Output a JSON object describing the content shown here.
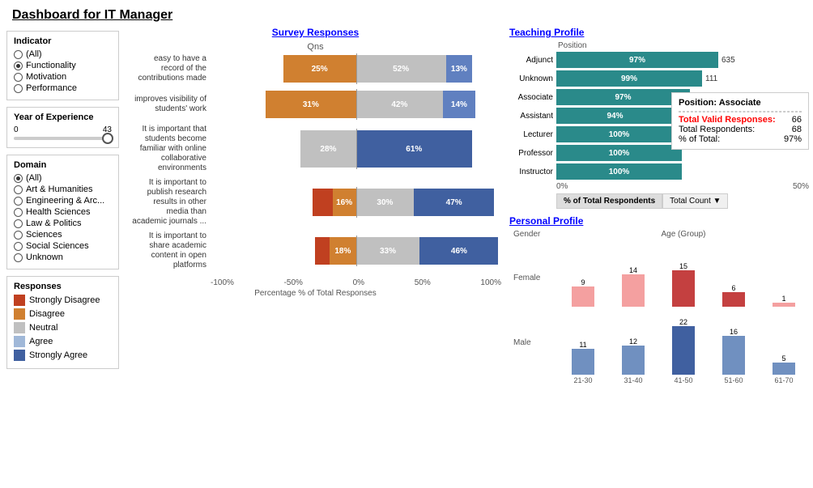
{
  "title": "Dashboard for IT Manager",
  "survey": {
    "section_title": "Survey Responses",
    "qns_label": "Qns",
    "x_axis_title": "Percentage % of Total Responses",
    "x_labels": [
      "-100%",
      "-50%",
      "0%",
      "50%",
      "100%"
    ],
    "questions": [
      {
        "label": "easy to have a record of the contributions made",
        "segments": [
          {
            "color": "#d08030",
            "width_pct": 25,
            "label": "25%",
            "side": "neg"
          },
          {
            "color": "#c0c0c0",
            "width_pct": 52,
            "label": "52%",
            "side": "pos"
          },
          {
            "color": "#6080c0",
            "width_pct": 13,
            "label": "13%",
            "side": "pos"
          }
        ]
      },
      {
        "label": "improves visibility of students' work",
        "segments": [
          {
            "color": "#d08030",
            "width_pct": 31,
            "label": "31%",
            "side": "neg"
          },
          {
            "color": "#c0c0c0",
            "width_pct": 42,
            "label": "42%",
            "side": "pos"
          },
          {
            "color": "#6080c0",
            "width_pct": 14,
            "label": "14%",
            "side": "pos"
          }
        ]
      },
      {
        "label": "It is important that students become familiar with online collaborative environments",
        "segments": [
          {
            "color": "#c0c0c0",
            "width_pct": 28,
            "label": "28%",
            "side": "neg"
          },
          {
            "color": "#6080c0",
            "width_pct": 61,
            "label": "61%",
            "side": "pos"
          }
        ]
      },
      {
        "label": "It is important to publish research results in other media than academic journals ...",
        "segments": [
          {
            "color": "#d08030",
            "width_pct": 16,
            "label": "16%",
            "side": "neg"
          },
          {
            "color": "#c0c0c0",
            "width_pct": 30,
            "label": "30%",
            "side": "pos"
          },
          {
            "color": "#6080c0",
            "width_pct": 47,
            "label": "47%",
            "side": "pos"
          }
        ]
      },
      {
        "label": "It is important to share academic content in open platforms",
        "segments": [
          {
            "color": "#d08030",
            "width_pct": 18,
            "label": "18%",
            "side": "neg"
          },
          {
            "color": "#c0c0c0",
            "width_pct": 33,
            "label": "33%",
            "side": "pos"
          },
          {
            "color": "#6080c0",
            "width_pct": 46,
            "label": "46%",
            "side": "pos"
          }
        ]
      }
    ]
  },
  "indicator": {
    "title": "Indicator",
    "options": [
      "(All)",
      "Functionality",
      "Motivation",
      "Performance"
    ],
    "selected": "Functionality"
  },
  "year_of_experience": {
    "title": "Year of Experience",
    "min": 0,
    "max": 43
  },
  "domain": {
    "title": "Domain",
    "options": [
      "(All)",
      "Art & Humanities",
      "Engineering & Arc...",
      "Health Sciences",
      "Law & Politics",
      "Sciences",
      "Social Sciences",
      "Unknown"
    ],
    "selected": "(All)"
  },
  "responses_legend": {
    "title": "Responses",
    "items": [
      {
        "label": "Strongly Disagree",
        "color": "#c04020"
      },
      {
        "label": "Disagree",
        "color": "#d08030"
      },
      {
        "label": "Neutral",
        "color": "#c0c0c0"
      },
      {
        "label": "Agree",
        "color": "#a0b8d8"
      },
      {
        "label": "Strongly Agree",
        "color": "#4060a0"
      }
    ]
  },
  "teaching": {
    "title": "Teaching Profile",
    "position_label": "Position",
    "rows": [
      {
        "label": "Adjunct",
        "pct": 97,
        "count": 635,
        "bar_color": "#2a8a8a"
      },
      {
        "label": "Unknown",
        "pct": 99,
        "count": 111,
        "bar_color": "#2a8a8a"
      },
      {
        "label": "Associate",
        "pct": 97,
        "count": 66,
        "bar_color": "#2a8a8a"
      },
      {
        "label": "Assistant",
        "pct": 94,
        "count": null,
        "bar_color": "#2a8a8a"
      },
      {
        "label": "Lecturer",
        "pct": 100,
        "count": null,
        "bar_color": "#2a8a8a"
      },
      {
        "label": "Professor",
        "pct": 100,
        "count": null,
        "bar_color": "#2a8a8a"
      },
      {
        "label": "Instructor",
        "pct": 100,
        "count": null,
        "bar_color": "#2a8a8a"
      }
    ],
    "tooltip": {
      "title": "Position: Associate",
      "total_valid_label": "Total Valid Responses:",
      "total_valid_value": "66",
      "total_respondents_label": "Total Respondents:",
      "total_respondents_value": "68",
      "pct_total_label": "% of Total:",
      "pct_total_value": "97%"
    },
    "tabs": [
      "% of Total Respondents",
      "Total Count"
    ]
  },
  "personal": {
    "title": "Personal Profile",
    "gender_label": "Gender",
    "age_label": "Age (Group)",
    "female_label": "Female",
    "male_label": "Male",
    "age_groups": [
      "21-30",
      "31-40",
      "41-50",
      "51-60",
      "61-70"
    ],
    "female_values": [
      9,
      14,
      15,
      6,
      1
    ],
    "male_values": [
      11,
      12,
      22,
      16,
      5
    ]
  }
}
